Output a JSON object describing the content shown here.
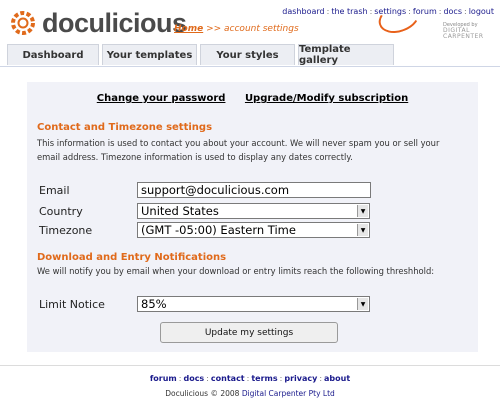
{
  "brand": {
    "name": "doculicious",
    "developer_line": "Developed by",
    "developer_name": "DIGITAL CARPENTER"
  },
  "breadcrumb": {
    "home": "Home",
    "current": ">> account settings"
  },
  "top_links": [
    "dashboard",
    "the trash",
    "settings",
    "forum",
    "docs",
    "logout"
  ],
  "tabs": [
    "Dashboard",
    "Your templates",
    "Your styles",
    "Template gallery"
  ],
  "account_links": {
    "change_password": "Change your password",
    "upgrade": "Upgrade/Modify subscription"
  },
  "contact": {
    "heading": "Contact and Timezone settings",
    "description": "This information is used to contact you about your account. We will never spam you or sell your email address. Timezone information is used to display any dates correctly.",
    "email_label": "Email",
    "email_value": "support@doculicious.com",
    "country_label": "Country",
    "country_value": "United States",
    "timezone_label": "Timezone",
    "timezone_value": "(GMT -05:00) Eastern Time"
  },
  "notifications": {
    "heading": "Download and Entry Notifications",
    "description": "We will notify you by email when your download or entry limits reach the following threshhold:",
    "limit_label": "Limit Notice",
    "limit_value": "85%"
  },
  "update_button": "Update my settings",
  "footer": {
    "links": [
      "forum",
      "docs",
      "contact",
      "terms",
      "privacy",
      "about"
    ],
    "copyright": "Doculicious © 2008",
    "company": "Digital Carpenter Pty Ltd"
  },
  "colors": {
    "accent": "#e06a1b",
    "link": "#1a1a8c",
    "panel": "#f1f2f8"
  }
}
